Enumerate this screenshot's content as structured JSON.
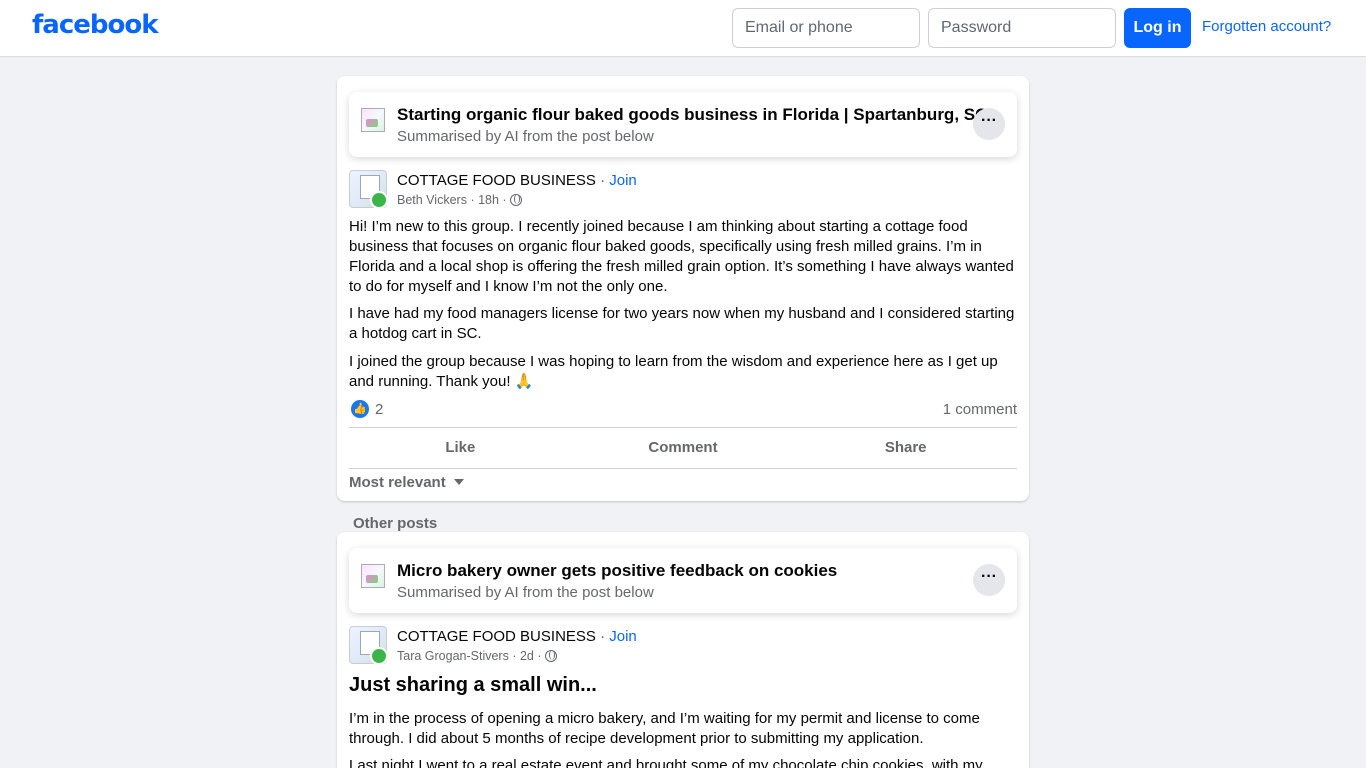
{
  "header": {
    "logo": "facebook",
    "email_placeholder": "Email or phone",
    "password_placeholder": "Password",
    "login_label": "Log in",
    "forgot_label": "Forgotten account?"
  },
  "post1": {
    "summary_title": "Starting organic flour baked goods business in Florida | Spartanburg, SC",
    "summary_sub": "Summarised by AI from the post below",
    "more_label": "···",
    "group": "COTTAGE FOOD BUSINESS",
    "join": "· Join",
    "author": "Beth Vickers",
    "time": "· 18h ·",
    "paragraphs": [
      "Hi! I’m new to this group. I recently joined because I am thinking about starting a cottage food business that focuses on organic flour baked goods, specifically using fresh milled grains. I’m in Florida and a local shop is offering the fresh milled grain option. It’s something I have always wanted to do for myself and I know I’m not the only one.",
      "I have had my food managers license for two years now when my husband and I considered starting a hotdog cart in SC.",
      "I joined the group because I was hoping to learn from the wisdom and experience here as I get up and running. Thank you! 🙏"
    ],
    "like_count": "2",
    "comment_count": "1 comment",
    "actions": [
      "Like",
      "Comment",
      "Share"
    ],
    "sort_label": "Most relevant"
  },
  "other_posts_label": "Other posts",
  "post2": {
    "summary_title": "Micro bakery owner gets positive feedback on cookies",
    "summary_sub": "Summarised by AI from the post below",
    "more_label": "···",
    "group": "COTTAGE FOOD BUSINESS",
    "join": "· Join",
    "author": "Tara Grogan-Stivers",
    "time": "· 2d ·",
    "heading": "Just sharing a small win...",
    "paragraphs": [
      "I’m in the process of opening a micro bakery, and I’m waiting for my permit and license to come through. I did about 5 months of recipe development prior to submitting my application.",
      "Last night I went to a real estate event and brought some of my chocolate chip cookies, with my"
    ]
  },
  "colors": {
    "brand_blue": "#0866ff",
    "background": "#f0f2f5",
    "secondary_text": "#65676b"
  }
}
